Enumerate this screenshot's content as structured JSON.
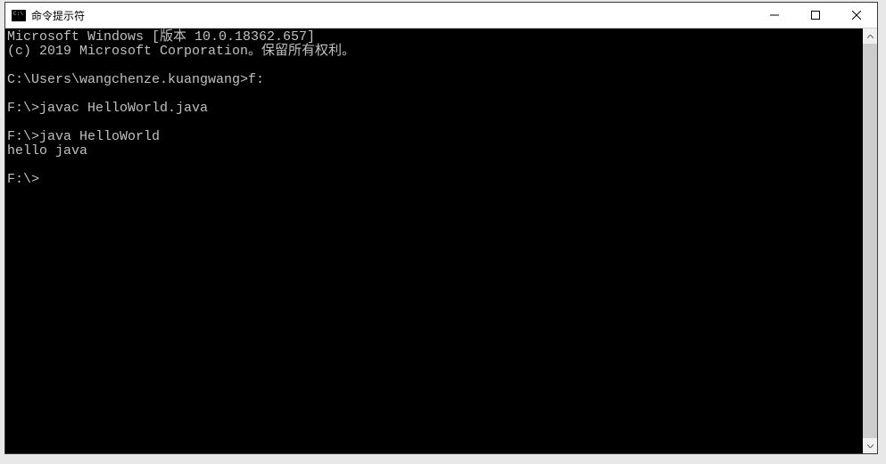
{
  "window": {
    "title": "命令提示符"
  },
  "terminal": {
    "lines": [
      "Microsoft Windows [版本 10.0.18362.657]",
      "(c) 2019 Microsoft Corporation。保留所有权利。",
      "",
      "C:\\Users\\wangchenze.kuangwang>f:",
      "",
      "F:\\>javac HelloWorld.java",
      "",
      "F:\\>java HelloWorld",
      "hello java",
      "",
      "F:\\>"
    ]
  }
}
